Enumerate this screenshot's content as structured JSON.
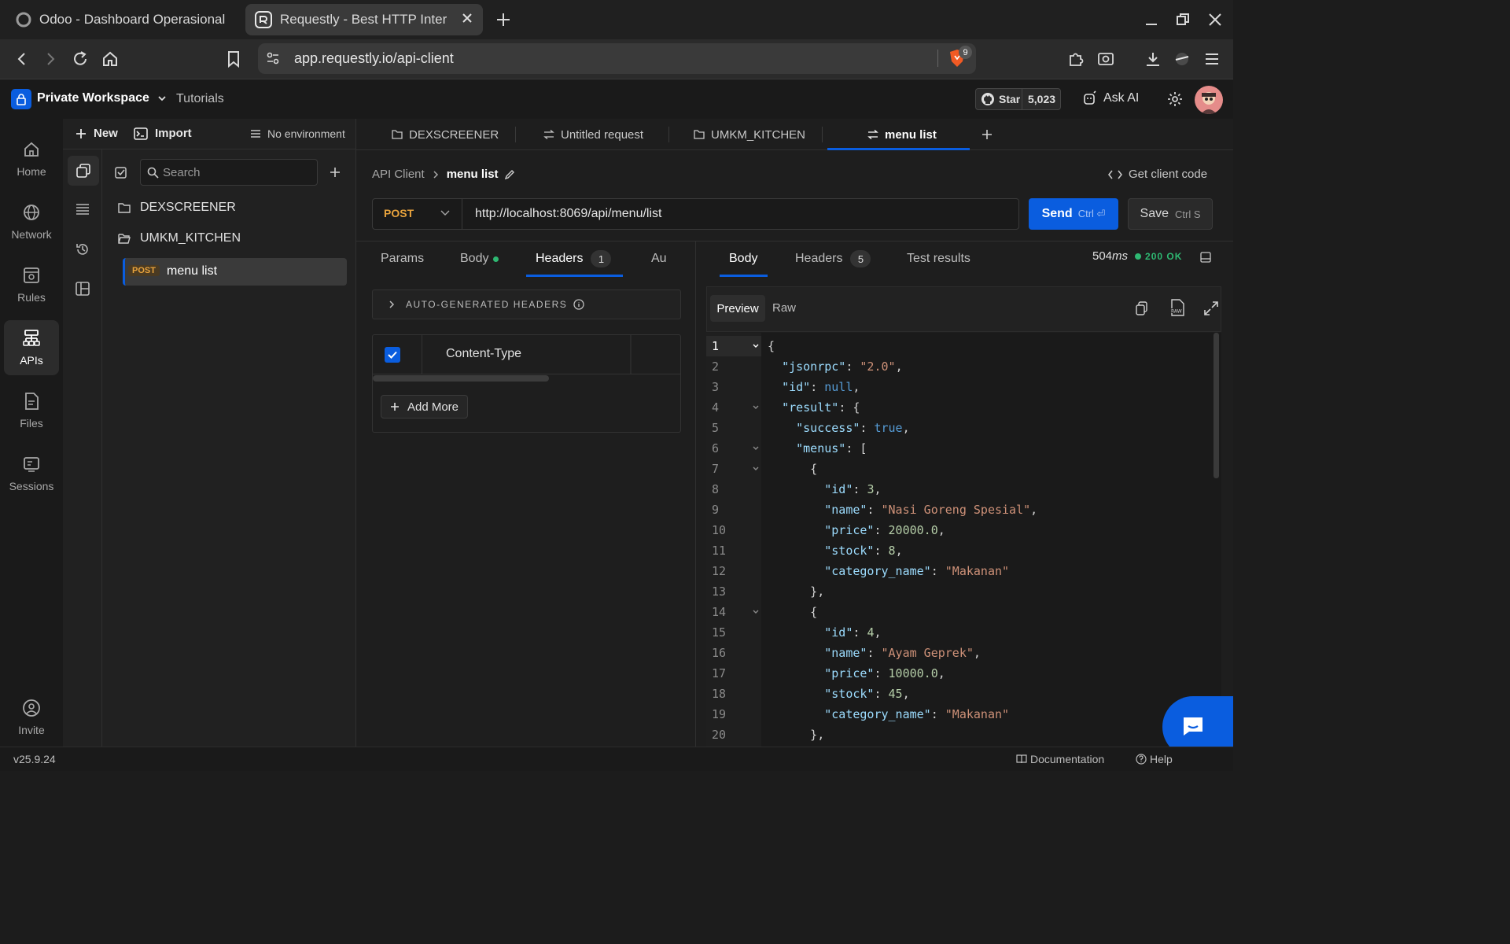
{
  "browser": {
    "tabs": [
      {
        "title": "Odoo - Dashboard Operasional"
      },
      {
        "title": "Requestly - Best HTTP Inter"
      }
    ],
    "url": "app.requestly.io/api-client",
    "brave_badge": "9"
  },
  "header": {
    "workspace": "Private Workspace",
    "tutorials": "Tutorials",
    "github_star": "Star",
    "github_count": "5,023",
    "ask_ai": "Ask AI"
  },
  "rail": {
    "items": [
      {
        "label": "Home",
        "icon": "home-icon"
      },
      {
        "label": "Network",
        "icon": "globe-icon"
      },
      {
        "label": "Rules",
        "icon": "rules-icon"
      },
      {
        "label": "APIs",
        "icon": "api-icon"
      },
      {
        "label": "Files",
        "icon": "file-icon"
      },
      {
        "label": "Sessions",
        "icon": "sessions-icon"
      }
    ],
    "invite": "Invite"
  },
  "sidebar": {
    "new": "New",
    "import": "Import",
    "environment": "No environment",
    "search_placeholder": "Search",
    "tree": [
      {
        "name": "DEXSCREENER"
      },
      {
        "name": "UMKM_KITCHEN"
      }
    ],
    "request": {
      "method": "POST",
      "name": "menu list"
    }
  },
  "request_tabs": [
    {
      "label": "DEXSCREENER",
      "icon": "folder-icon"
    },
    {
      "label": "Untitled request",
      "icon": "swap-icon"
    },
    {
      "label": "UMKM_KITCHEN",
      "icon": "folder-icon"
    },
    {
      "label": "menu list",
      "icon": "swap-icon"
    }
  ],
  "breadcrumb": {
    "root": "API Client",
    "current": "menu list"
  },
  "get_client_code": "Get client code",
  "request": {
    "method": "POST",
    "url": "http://localhost:8069/api/menu/list",
    "send": "Send",
    "send_shortcut": "Ctrl ⏎",
    "save": "Save",
    "save_shortcut": "Ctrl S"
  },
  "request_subtabs": {
    "params": "Params",
    "body": "Body",
    "headers": "Headers",
    "headers_count": "1",
    "auth": "Au"
  },
  "headers_panel": {
    "auto_generated": "AUTO-GENERATED HEADERS",
    "rows": [
      {
        "key": "Content-Type",
        "checked": true
      }
    ],
    "add_more": "Add More"
  },
  "response_tabs": {
    "body": "Body",
    "headers": "Headers",
    "headers_count": "5",
    "tests": "Test results",
    "time_value": "504",
    "time_unit": "ms",
    "status": "200 OK"
  },
  "response_view": {
    "preview": "Preview",
    "raw": "Raw"
  },
  "status_bar": {
    "version": "v25.9.24",
    "documentation": "Documentation",
    "help": "Help"
  },
  "colors": {
    "accent_blue": "#0a5ddf",
    "method_post": "#e8a33d",
    "status_green": "#2eb872"
  }
}
